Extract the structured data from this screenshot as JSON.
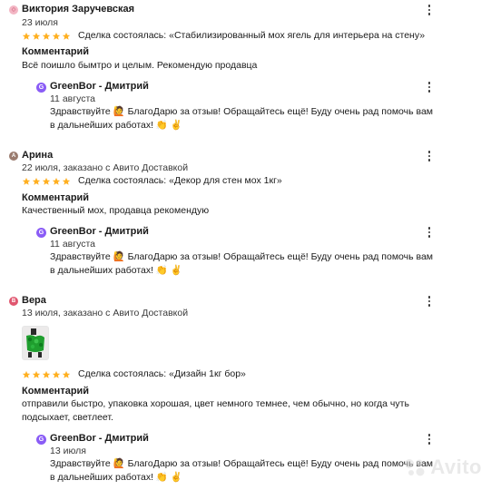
{
  "colors": {
    "star": "#ffb021",
    "accent": "#8a5cf6"
  },
  "icons": {
    "star": "star-icon",
    "menu": "kebab-menu-icon"
  },
  "reviews": [
    {
      "avatar": "◇",
      "name": "Виктория Заручевская",
      "meta": "23 июля",
      "deal": "Сделка состоялась: «Стабилизированный мох ягель для интерьера на стену»",
      "comment_label": "Комментарий",
      "comment": "Всё поишло бымтро и целым. Рекомендую продавца",
      "reply": {
        "avatar": "G",
        "name": "GreenBor - Дмитрий",
        "date": "11 августа",
        "text": "Здравствуйте 🙋 БлагоДарю за отзыв! Обращайтесь ещё! Буду очень рад помочь вам в дальнейших работах! 👏 ✌️"
      }
    },
    {
      "avatar": "A",
      "name": "Арина",
      "meta": "22 июля, заказано с Авито Доставкой",
      "deal": "Сделка состоялась: «Декор для стен мох 1кг»",
      "comment_label": "Комментарий",
      "comment": "Качественный мох, продавца рекомендую",
      "reply": {
        "avatar": "G",
        "name": "GreenBor - Дмитрий",
        "date": "11 августа",
        "text": "Здравствуйте 🙋 БлагоДарю за отзыв! Обращайтесь ещё! Буду очень рад помочь вам в дальнейших работах! 👏 ✌️"
      }
    },
    {
      "avatar": "В",
      "name": "Вера",
      "meta": "13 июля, заказано с Авито Доставкой",
      "deal": "Сделка состоялась: «Дизайн 1кг бор»",
      "comment_label": "Комментарий",
      "comment": "отправили быстро, упаковка хорошая, цвет немного темнее, чем обычно, но когда чуть подсыхает, светлеет.",
      "reply": {
        "avatar": "G",
        "name": "GreenBor - Дмитрий",
        "date": "13 июля",
        "text": "Здравствуйте 🙋 БлагоДарю за отзыв! Обращайтесь ещё! Буду очень рад помочь вам в дальнейших работах! 👏 ✌️"
      }
    }
  ],
  "watermark": "Avito"
}
